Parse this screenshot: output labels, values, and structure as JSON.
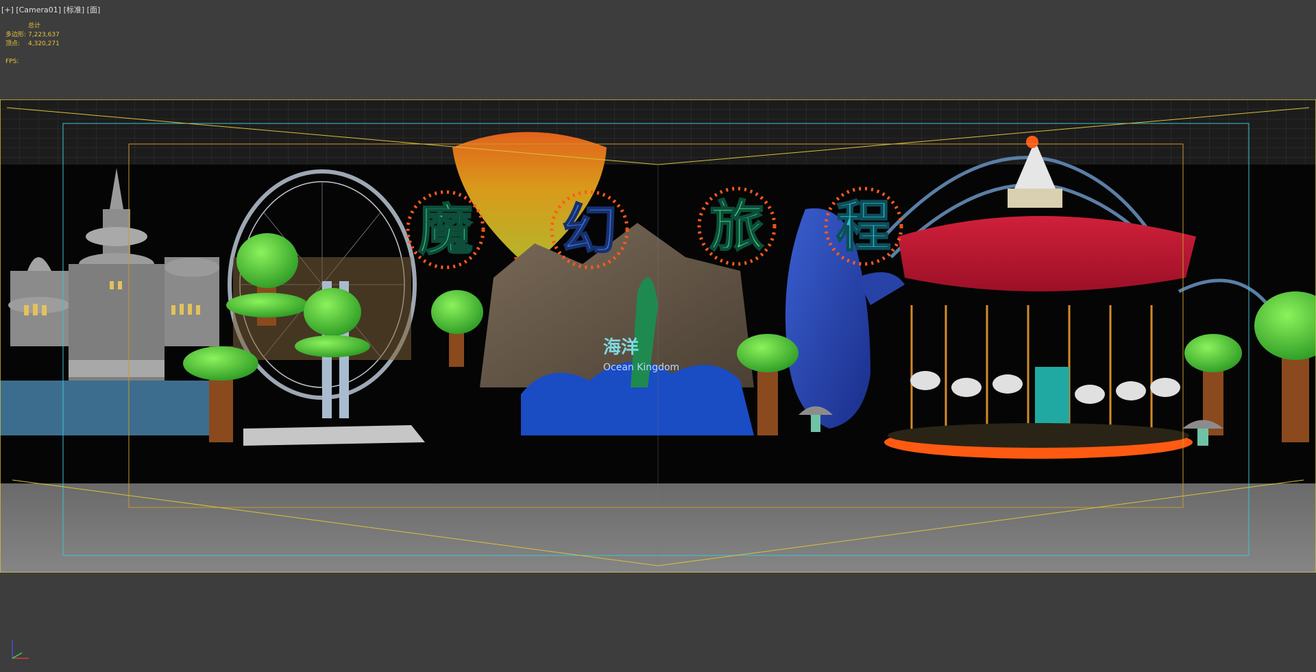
{
  "viewport": {
    "label_plus": "[+]",
    "label_camera": "[Camera01]",
    "label_shading": "[标准]",
    "label_mode": "[面]"
  },
  "stats": {
    "header": "总计",
    "polys_label": "多边形:",
    "polys_value": "7,223,637",
    "verts_label": "顶点:",
    "verts_value": "4,320,271",
    "fps_label": "FPS:"
  },
  "scene": {
    "sign_chars": [
      "魔",
      "幻",
      "旅",
      "程"
    ],
    "ocean_text": "海洋",
    "ocean_sub": "Ocean Kingdom"
  },
  "colors": {
    "viewport_bg": "#3d3d3d",
    "stats_text": "#e8c43a",
    "frame_yellow": "#d7c33a",
    "frame_cyan": "#3fc3d4",
    "frame_orange": "#c79a2e"
  }
}
